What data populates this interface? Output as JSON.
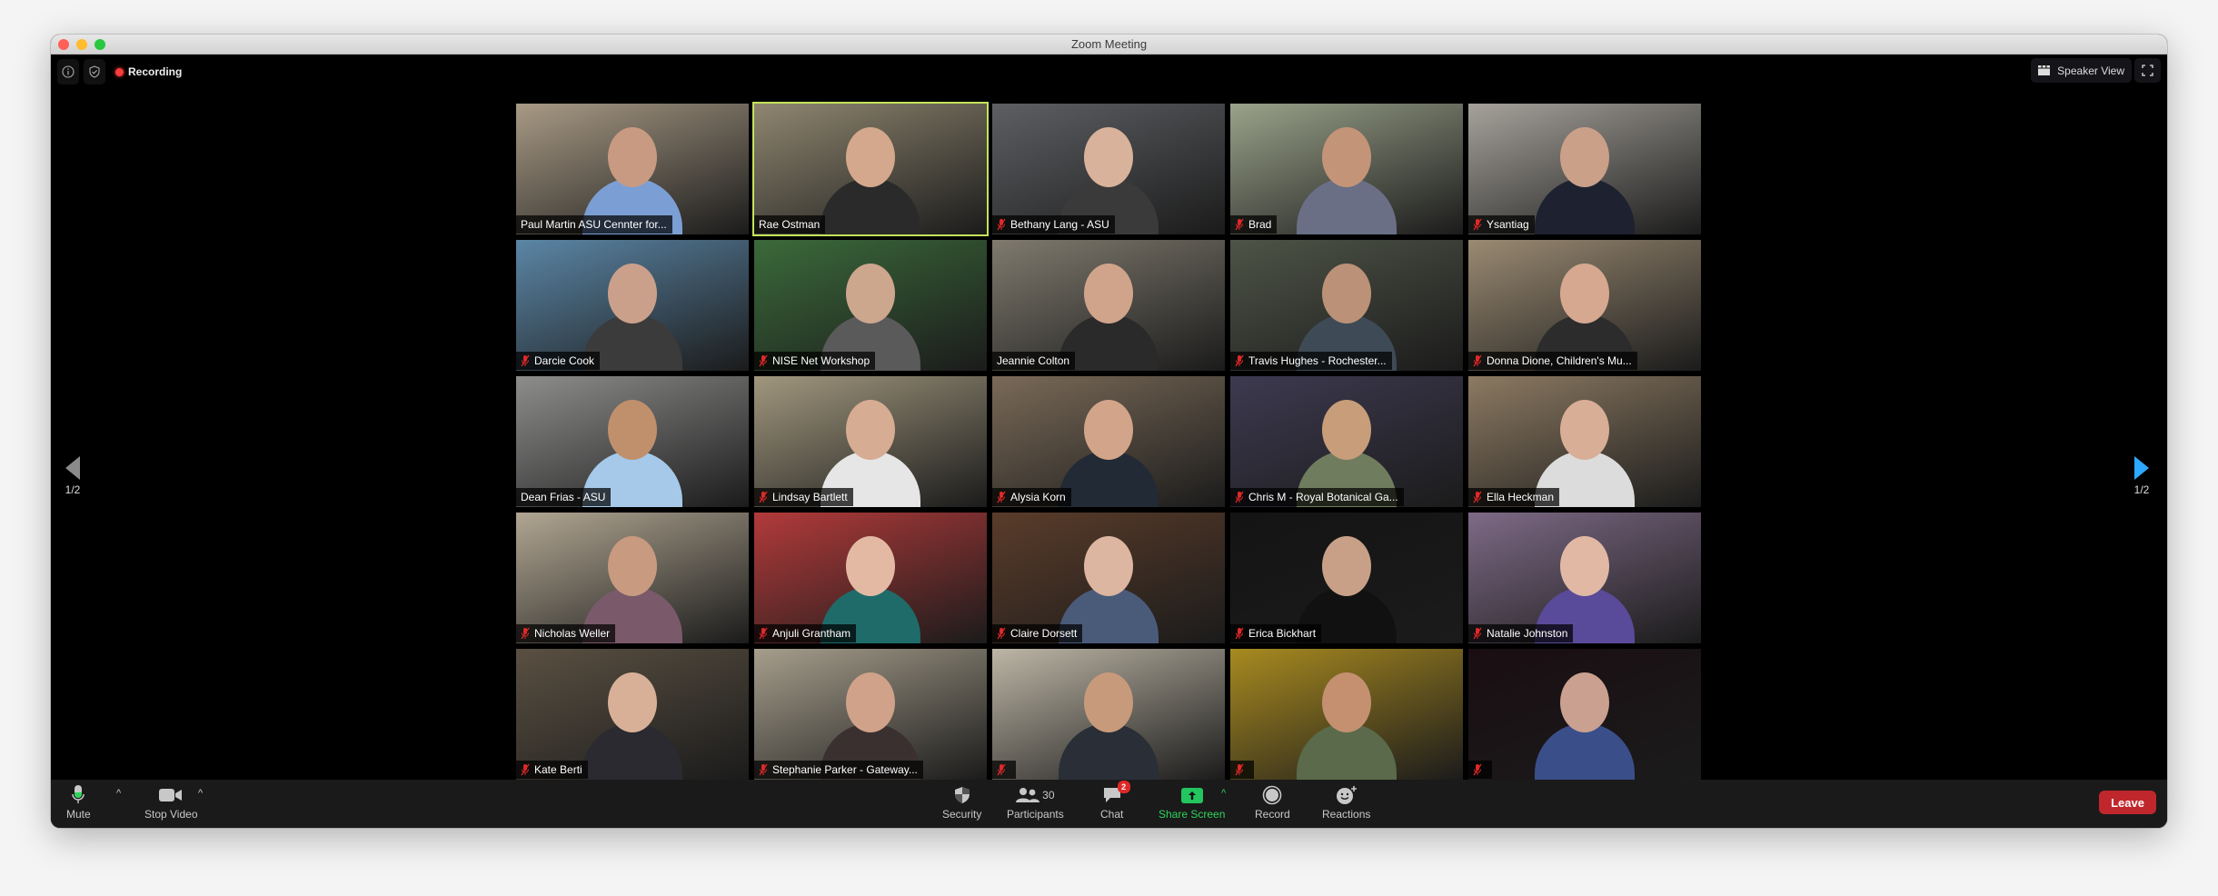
{
  "window": {
    "title": "Zoom Meeting"
  },
  "top_bar": {
    "info_icon": "info-icon",
    "security_icon": "shield-check-icon",
    "recording_label": "Recording",
    "speaker_view_label": "Speaker View",
    "fullscreen_icon": "fullscreen-icon"
  },
  "pager": {
    "left_label": "1/2",
    "right_label": "1/2"
  },
  "participants": [
    {
      "name": "Paul Martin ASU Cennter for...",
      "muted": false,
      "active": false,
      "bg": "#a89a85",
      "shirt": "#7b9fd4",
      "skin": "#c89a82"
    },
    {
      "name": "Rae Ostman",
      "muted": false,
      "active": true,
      "bg": "#8f8670",
      "shirt": "#2a2a2a",
      "skin": "#d4a88c"
    },
    {
      "name": "Bethany Lang - ASU",
      "muted": true,
      "active": false,
      "bg": "#5d5f63",
      "shirt": "#3a3a3a",
      "skin": "#d8b29a"
    },
    {
      "name": "Brad",
      "muted": true,
      "active": false,
      "bg": "#9aa28a",
      "shirt": "#6a6f86",
      "skin": "#c49478"
    },
    {
      "name": "Ysantiag",
      "muted": true,
      "active": false,
      "bg": "#a6a29b",
      "shirt": "#1e2230",
      "skin": "#caa088"
    },
    {
      "name": "Darcie Cook",
      "muted": true,
      "active": false,
      "bg": "#5b86a6",
      "shirt": "#3b3b3b",
      "skin": "#caa08a"
    },
    {
      "name": "NISE Net Workshop",
      "muted": true,
      "active": false,
      "bg": "#3b6a3a",
      "shirt": "#5a5a5a",
      "skin": "#cda68e"
    },
    {
      "name": "Jeannie Colton",
      "muted": false,
      "active": false,
      "bg": "#7f7a6e",
      "shirt": "#2a2a2a",
      "skin": "#d0a48a"
    },
    {
      "name": "Travis Hughes - Rochester...",
      "muted": true,
      "active": false,
      "bg": "#4e5447",
      "shirt": "#3e4a55",
      "skin": "#bb9178"
    },
    {
      "name": "Donna Dione, Children's Mu...",
      "muted": true,
      "active": false,
      "bg": "#9a8a72",
      "shirt": "#2c2c2c",
      "skin": "#d6a890"
    },
    {
      "name": "Dean Frias - ASU",
      "muted": false,
      "active": false,
      "bg": "#8d8e8c",
      "shirt": "#a6c9ea",
      "skin": "#c0906c"
    },
    {
      "name": "Lindsay Bartlett",
      "muted": true,
      "active": false,
      "bg": "#a1977e",
      "shirt": "#e6e6e6",
      "skin": "#d6ac92"
    },
    {
      "name": "Alysia Korn",
      "muted": true,
      "active": false,
      "bg": "#7a6a58",
      "shirt": "#222a35",
      "skin": "#d2a48a"
    },
    {
      "name": "Chris M - Royal Botanical Ga...",
      "muted": true,
      "active": false,
      "bg": "#3d3a50",
      "shirt": "#6f7d5e",
      "skin": "#c89d7a"
    },
    {
      "name": "Ella Heckman",
      "muted": true,
      "active": false,
      "bg": "#8c7a62",
      "shirt": "#dcdcdc",
      "skin": "#d8ae96"
    },
    {
      "name": "Nicholas Weller",
      "muted": true,
      "active": false,
      "bg": "#b1a692",
      "shirt": "#7a5a6a",
      "skin": "#c89a80"
    },
    {
      "name": "Anjuli Grantham",
      "muted": true,
      "active": false,
      "bg": "#b23a3a",
      "shirt": "#1f6b6a",
      "skin": "#e3b9a4"
    },
    {
      "name": "Claire Dorsett",
      "muted": true,
      "active": false,
      "bg": "#5a3c2a",
      "shirt": "#4a5b7a",
      "skin": "#dcb6a0"
    },
    {
      "name": "Erica Bickhart",
      "muted": true,
      "active": false,
      "bg": "#141414",
      "shirt": "#111111",
      "skin": "#c8a088"
    },
    {
      "name": "Natalie Johnston",
      "muted": true,
      "active": false,
      "bg": "#7e6a86",
      "shirt": "#5a4a9a",
      "skin": "#e0b8a4"
    },
    {
      "name": "Kate Berti",
      "muted": true,
      "active": false,
      "bg": "#5a5042",
      "shirt": "#2a2a30",
      "skin": "#d8b098"
    },
    {
      "name": "Stephanie Parker - Gateway...",
      "muted": true,
      "active": false,
      "bg": "#a69e8c",
      "shirt": "#3a3030",
      "skin": "#d0a28a"
    },
    {
      "name": "",
      "muted": true,
      "active": false,
      "bg": "#bdb6a6",
      "shirt": "#2a2e36",
      "skin": "#c89a7c"
    },
    {
      "name": "",
      "muted": true,
      "active": false,
      "bg": "#a88a20",
      "shirt": "#5a6a4a",
      "skin": "#c49070"
    },
    {
      "name": "",
      "muted": true,
      "active": false,
      "bg": "#1a0e12",
      "shirt": "#3a4f8a",
      "skin": "#caa090"
    }
  ],
  "toolbar": {
    "mute_label": "Mute",
    "stop_video_label": "Stop Video",
    "security_label": "Security",
    "participants_label": "Participants",
    "participants_count": "30",
    "chat_label": "Chat",
    "chat_badge": "2",
    "share_screen_label": "Share Screen",
    "record_label": "Record",
    "reactions_label": "Reactions",
    "leave_label": "Leave"
  },
  "colors": {
    "accent_green": "#2fd35b",
    "leave_red": "#c0272d",
    "active_speaker_border": "#c4e35a",
    "pager_blue": "#2ea8ff"
  }
}
